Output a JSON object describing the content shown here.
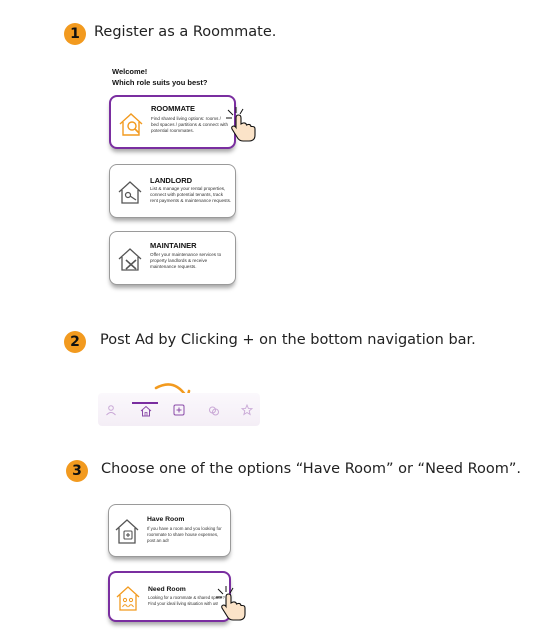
{
  "steps": [
    {
      "number": "1",
      "text": "Register as a Roommate."
    },
    {
      "number": "2",
      "text": "Post Ad by Clicking + on the bottom navigation bar."
    },
    {
      "number": "3",
      "text": "Choose one of the options “Have Room” or “Need Room”."
    }
  ],
  "welcome": {
    "line1": "Welcome!",
    "line2": "Which role suits you best?"
  },
  "roles": [
    {
      "title": "ROOMMATE",
      "desc": "Find shared living options: rooms / bed spaces / partitions & connect with potential roommates.",
      "icon": "house-search-icon",
      "selected": true
    },
    {
      "title": "LANDLORD",
      "desc": "List & manage your rental properties, connect with potential tenants, track rent payments & maintenance requests.",
      "icon": "house-key-icon",
      "selected": false
    },
    {
      "title": "MAINTAINER",
      "desc": "Offer your maintenance services to property landlords & receive maintenance requests.",
      "icon": "house-tools-icon",
      "selected": false
    }
  ],
  "nav_items": [
    "profile-icon",
    "home-icon",
    "add-post-icon",
    "chat-icon",
    "star-icon"
  ],
  "room_options": [
    {
      "title": "Have Room",
      "desc": "If you have a room and you looking for roommate to share house expenses, post an ad!",
      "icon": "house-plus-icon",
      "selected": false
    },
    {
      "title": "Need Room",
      "desc": "Looking for a roommate & shared space? Find your ideal living situation with us!",
      "icon": "house-people-icon",
      "selected": true
    }
  ],
  "colors": {
    "accent_orange": "#f29a1f",
    "accent_purple": "#7a2ea0"
  }
}
